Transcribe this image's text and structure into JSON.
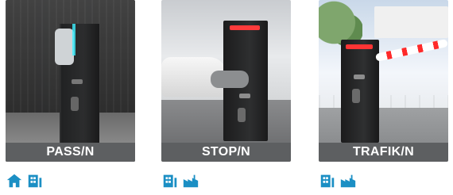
{
  "products": [
    {
      "name": "PASS/N",
      "icons": [
        "home-icon",
        "building-icon"
      ]
    },
    {
      "name": "STOP/N",
      "icons": [
        "building-icon",
        "factory-icon"
      ]
    },
    {
      "name": "TRAFIK/N",
      "icons": [
        "building-icon",
        "factory-icon"
      ]
    }
  ],
  "colors": {
    "caption_bg": "#5d5f61",
    "caption_text": "#ffffff",
    "icon": "#1b8fc4"
  }
}
